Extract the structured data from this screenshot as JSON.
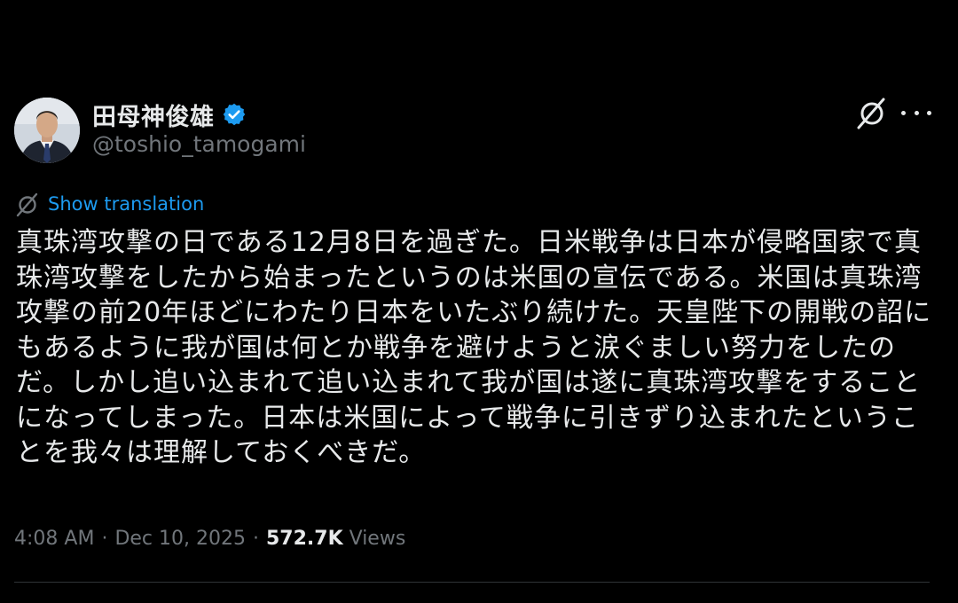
{
  "author": {
    "display_name": "田母神俊雄",
    "handle": "@toshio_tamogami",
    "verified_color": "#1d9bf0"
  },
  "actions": {
    "grok_icon": "grok-icon",
    "more_icon": "more-icon"
  },
  "translation": {
    "label": "Show translation",
    "icon": "translate-icon",
    "color": "#1d9bf0"
  },
  "tweet": {
    "lines": [
      "真珠湾攻撃の日である12月8日を過ぎた。日米戦争は日本が侵略国家で真",
      "珠湾攻撃をしたから始まったというのは米国の宣伝である。米国は真珠湾",
      "攻撃の前20年ほどにわたり日本をいたぶり続けた。天皇陛下の開戦の詔に",
      "もあるように我が国は何とか戦争を避けようと涙ぐましい努力をしたの",
      "だ。しかし追い込まれて追い込まれて我が国は遂に真珠湾攻撃をすること",
      "になってしまった。日本は米国によって戦争に引きずり込まれたというこ",
      "とを我々は理解しておくべきだ。"
    ]
  },
  "meta": {
    "time": "4:08 AM",
    "separator": "·",
    "date": "Dec 10, 2025",
    "views_count": "572.7K",
    "views_label": "Views"
  },
  "colors": {
    "background": "#000000",
    "text": "#e7e9ea",
    "secondary": "#71767b",
    "accent": "#1d9bf0"
  }
}
